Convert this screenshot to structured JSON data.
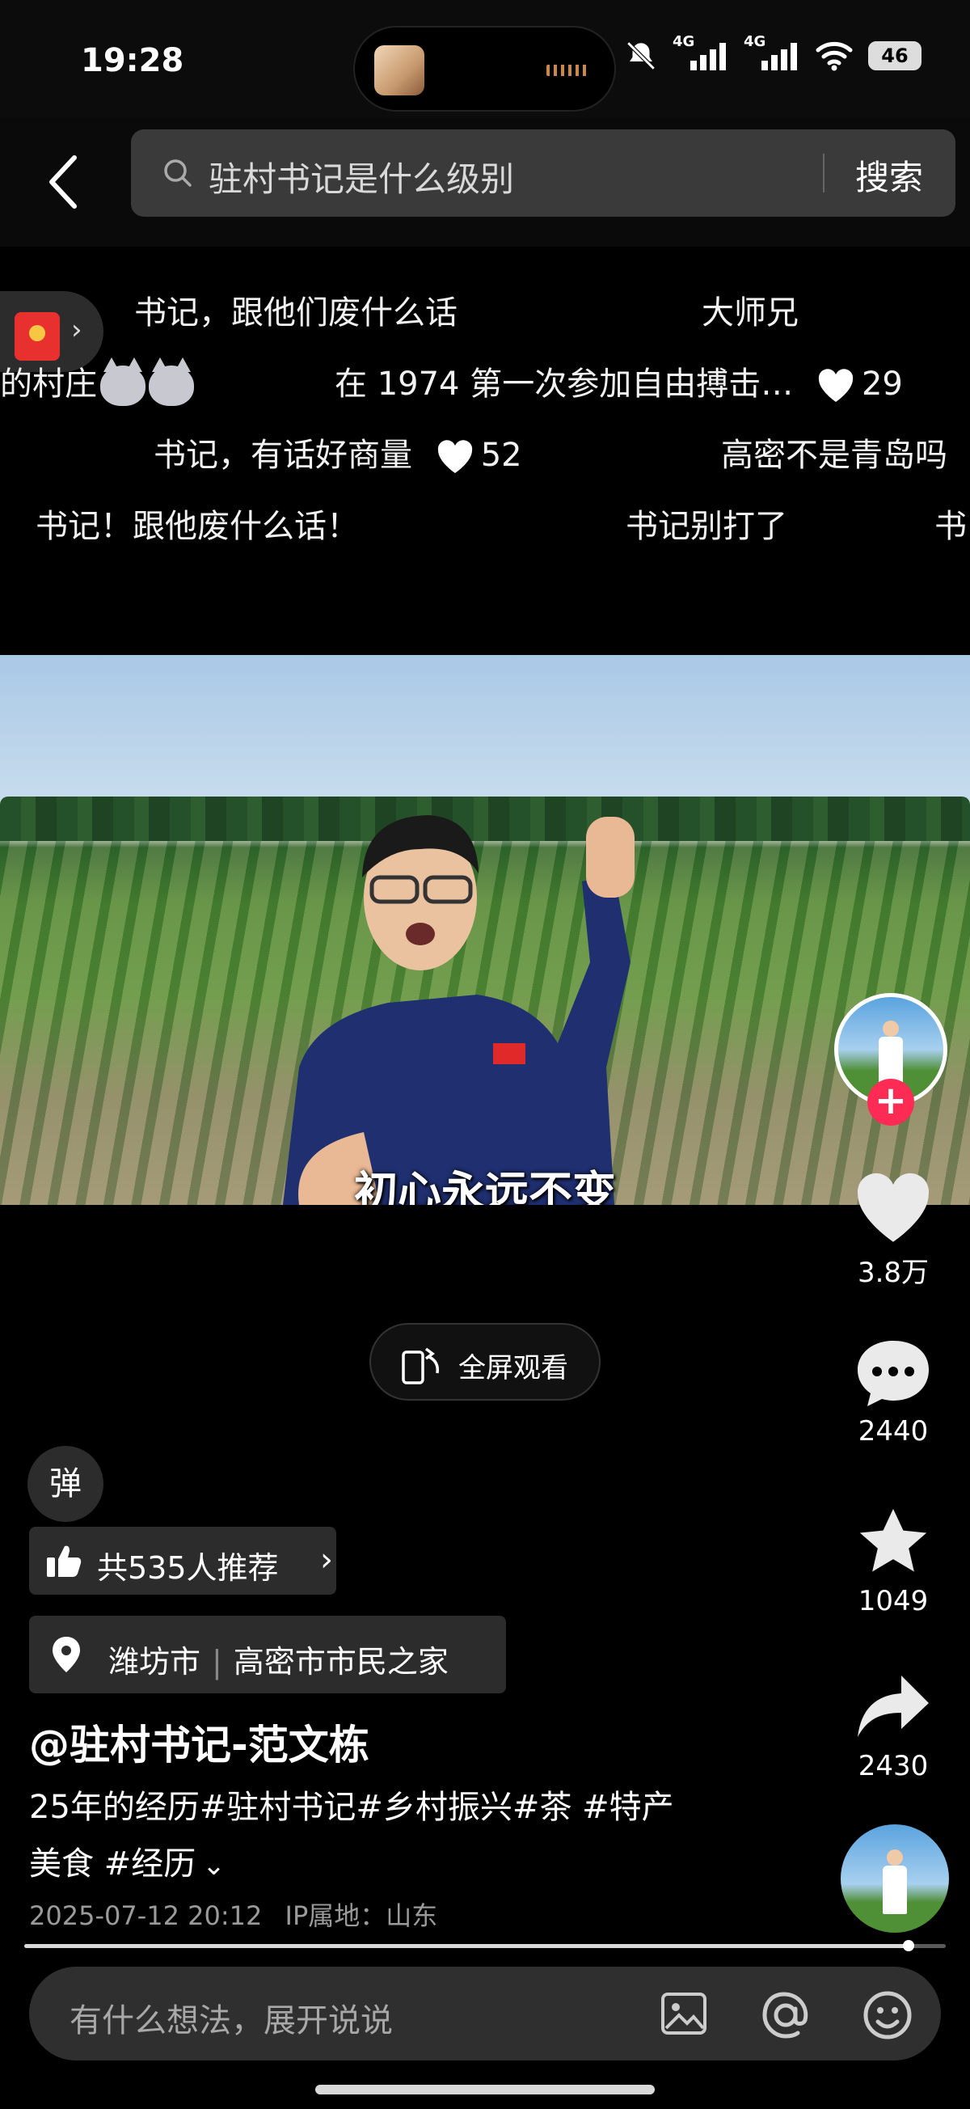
{
  "status_bar": {
    "time": "19:28",
    "battery": "46",
    "network_1": "4G",
    "network_2": "4G"
  },
  "search": {
    "query": "驻村书记是什么级别",
    "button": "搜索"
  },
  "danmaku": {
    "row1": [
      "书记，跟他们废什么话",
      "大师兄"
    ],
    "row2": {
      "left": "的村庄",
      "center": "在 1974 第一次参加自由搏击…",
      "likes": "29"
    },
    "row3": {
      "left": "书记，有话好商量",
      "likes": "52",
      "right": "高密不是青岛吗"
    },
    "row4": [
      "书记！跟他废什么话！",
      "书记别打了",
      "书"
    ]
  },
  "video": {
    "subtitle": "初心永远不变"
  },
  "fullscreen_label": "全屏观看",
  "rail": {
    "likes": "3.8万",
    "comments": "2440",
    "favorites": "1049",
    "shares": "2430"
  },
  "danmu_toggle": "弹",
  "recommend": "共535人推荐",
  "location": {
    "city": "潍坊市",
    "place": "高密市市民之家"
  },
  "author": "@驻村书记-范文栋",
  "description": {
    "line1": "25年的经历#驻村书记#乡村振兴#茶 #特产",
    "line2": "美食 #经历"
  },
  "meta": {
    "date": "2025-07-12 20:12",
    "ip": "IP属地：山东"
  },
  "progress": {
    "fraction": 0.96
  },
  "comment": {
    "placeholder": "有什么想法，展开说说"
  },
  "colors": {
    "accent": "#fe2c55",
    "background": "#000000",
    "panel": "#2c2c2c"
  }
}
